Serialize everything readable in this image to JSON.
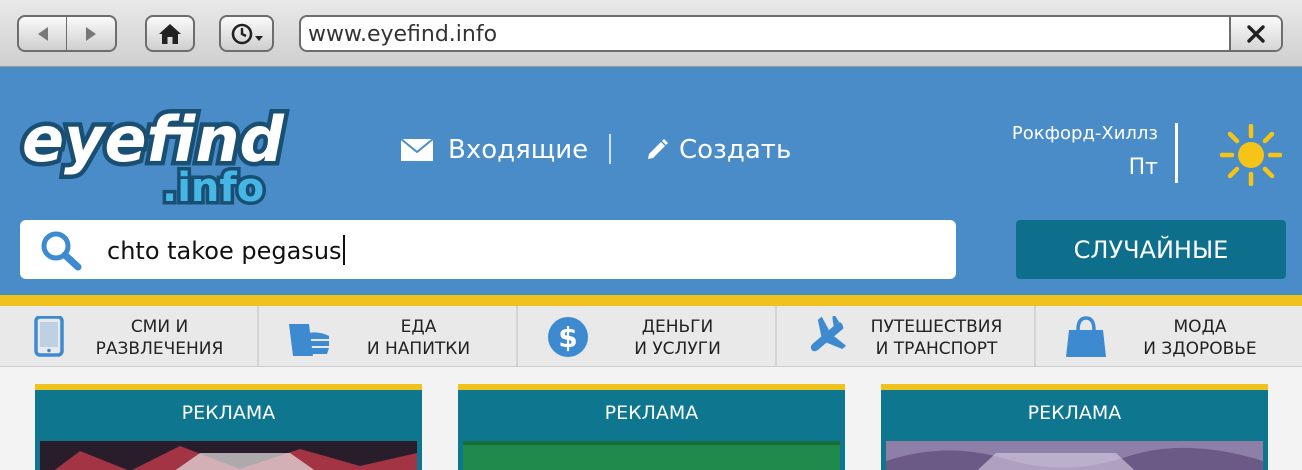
{
  "browser": {
    "url": "www.eyefind.info",
    "icons": [
      "back-arrow-icon",
      "forward-arrow-icon",
      "home-icon",
      "history-clock-icon",
      "close-icon"
    ]
  },
  "header": {
    "logo_main": "eyefind",
    "logo_sub": ".info",
    "inbox_label": "Входящие",
    "create_label": "Создать",
    "location": "Рокфорд-Хиллз",
    "day": "Пт",
    "weather_icon": "sun-icon"
  },
  "search": {
    "value": "chto takoe pegasus",
    "random_button": "СЛУЧАЙНЫЕ"
  },
  "categories": [
    {
      "line1": "СМИ И",
      "line2": "РАЗВЛЕЧЕНИЯ",
      "icon": "tablet-icon"
    },
    {
      "line1": "ЕДА",
      "line2": "И НАПИТКИ",
      "icon": "food-icon"
    },
    {
      "line1": "ДЕНЬГИ",
      "line2": "И УСЛУГИ",
      "icon": "dollar-icon"
    },
    {
      "line1": "ПУТЕШЕСТВИЯ",
      "line2": "И ТРАНСПОРТ",
      "icon": "airplane-icon"
    },
    {
      "line1": "МОДА",
      "line2": "И ЗДОРОВЬЕ",
      "icon": "shopping-bag-icon"
    }
  ],
  "ads": [
    {
      "label": "РЕКЛАМА"
    },
    {
      "label": "РЕКЛАМА"
    },
    {
      "label": "РЕКЛАМА"
    }
  ],
  "colors": {
    "header_blue": "#4a8cc7",
    "accent_yellow": "#f0c21e",
    "button_teal": "#0d6f8c",
    "icon_blue": "#3d8ad0"
  }
}
